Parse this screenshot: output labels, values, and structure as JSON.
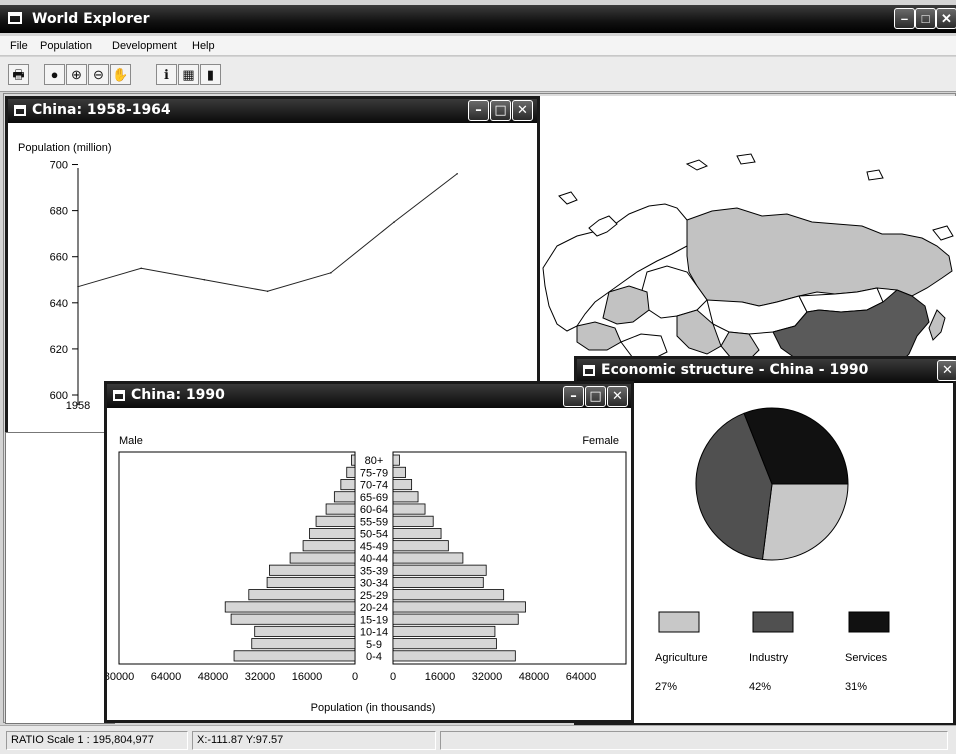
{
  "app": {
    "title": "World Explorer"
  },
  "menu": [
    "File",
    "Population",
    "Development",
    "Help"
  ],
  "toolbar": [
    {
      "icon": "print-icon",
      "glyph": "🖶"
    },
    {
      "icon": "globe-icon",
      "glyph": "●"
    },
    {
      "icon": "zoom-in-icon",
      "glyph": "⊕"
    },
    {
      "icon": "zoom-out-icon",
      "glyph": "⊖"
    },
    {
      "icon": "pan-hand-icon",
      "glyph": "✋"
    },
    {
      "icon": "info-icon",
      "glyph": "ℹ"
    },
    {
      "icon": "table-icon",
      "glyph": "▦"
    },
    {
      "icon": "bar-chart-icon",
      "glyph": "▮"
    }
  ],
  "line_window": {
    "title": "China: 1958-1964"
  },
  "pyramid_window": {
    "title": "China: 1990"
  },
  "econ_window": {
    "title": "Economic structure - China - 1990"
  },
  "status": {
    "scale": "RATIO Scale 1 : 195,804,977",
    "coords": "X:-111.87 Y:97.57"
  },
  "colors": {
    "agriculture": "#c8c8c8",
    "industry": "#505050",
    "services": "#111111",
    "map_highlight": "#c2c2c2",
    "china": "#5a5a5a",
    "bar": "#d6d6d6"
  },
  "chart_data": [
    {
      "type": "line",
      "ylabel": "Population (million)",
      "x": [
        1958,
        1959,
        1960,
        1961,
        1962,
        1963,
        1964
      ],
      "x_tick_labels": [
        "1958"
      ],
      "y": [
        647,
        655,
        650,
        645,
        653,
        675,
        696
      ],
      "ylim": [
        600,
        705
      ],
      "yticks": [
        600,
        620,
        640,
        660,
        680,
        700
      ]
    },
    {
      "type": "bar",
      "xlabel": "Population (in thousands)",
      "left_label": "Male",
      "right_label": "Female",
      "categories": [
        "80+",
        "75-79",
        "70-74",
        "65-69",
        "60-64",
        "55-59",
        "50-54",
        "45-49",
        "40-44",
        "35-39",
        "30-34",
        "25-29",
        "20-24",
        "15-19",
        "10-14",
        "5-9",
        "0-4"
      ],
      "series": [
        {
          "name": "Male",
          "values": [
            1200,
            2800,
            4800,
            7000,
            9800,
            13200,
            15400,
            17600,
            22000,
            29000,
            29800,
            36000,
            44000,
            42000,
            34000,
            35000,
            41000
          ]
        },
        {
          "name": "Female",
          "values": [
            2200,
            4300,
            6400,
            8600,
            11000,
            13800,
            16500,
            19000,
            24000,
            32000,
            31000,
            38000,
            45500,
            43000,
            35000,
            35500,
            42000
          ]
        }
      ],
      "ticks_left": [
        "80000",
        "64000",
        "48000",
        "32000",
        "16000",
        "0"
      ],
      "ticks_right": [
        "0",
        "16000",
        "32000",
        "48000",
        "64000"
      ],
      "xlim": [
        0,
        80000
      ]
    },
    {
      "type": "pie",
      "categories": [
        "Agriculture",
        "Industry",
        "Services"
      ],
      "values": [
        27,
        42,
        31
      ],
      "labels": [
        "27%",
        "42%",
        "31%"
      ]
    }
  ]
}
